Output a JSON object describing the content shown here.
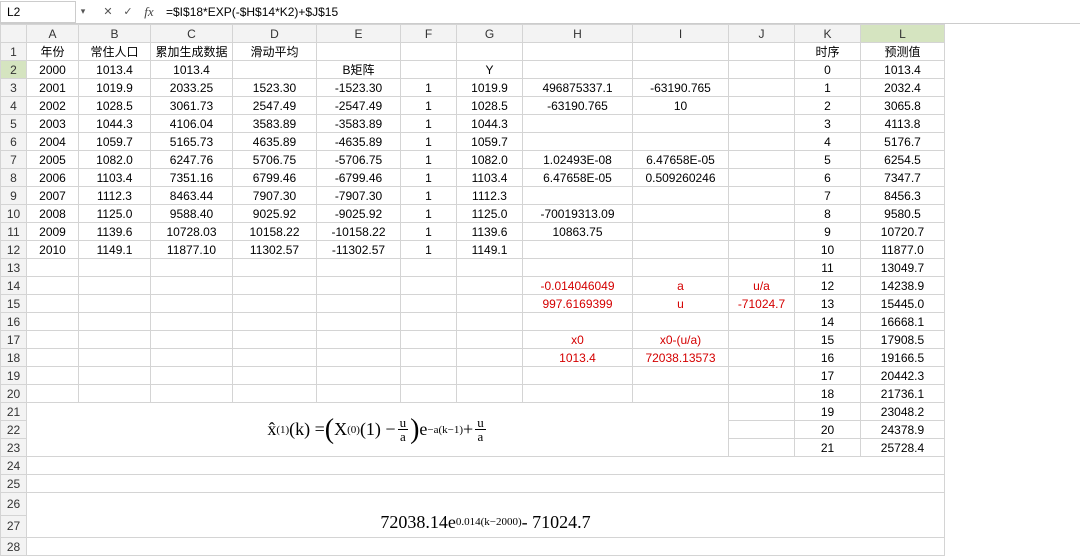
{
  "formula_bar": {
    "name_box": "L2",
    "dropdown_glyph": "▾",
    "btn_cancel": "✕",
    "btn_confirm": "✓",
    "fx": "fx",
    "formula": "=$I$18*EXP(-$H$14*K2)+$J$15"
  },
  "columns": [
    "A",
    "B",
    "C",
    "D",
    "E",
    "F",
    "G",
    "H",
    "I",
    "J",
    "K",
    "L"
  ],
  "selected_cell": "L2",
  "headers": {
    "A": "年份",
    "B": "常住人口",
    "C": "累加生成数据",
    "D": "滑动平均",
    "E_row2": "B矩阵",
    "G_row2": "Y",
    "K": "时序",
    "L": "预测值"
  },
  "rows": [
    {
      "r": 2,
      "A": "2000",
      "B": "1013.4",
      "C": "1013.4",
      "D": "",
      "E": "",
      "F": "",
      "G": "",
      "H": "",
      "I": "",
      "K": "0",
      "L": "1013.4"
    },
    {
      "r": 3,
      "A": "2001",
      "B": "1019.9",
      "C": "2033.25",
      "D": "1523.30",
      "E": "-1523.30",
      "F": "1",
      "G": "1019.9",
      "H": "496875337.1",
      "I": "-63190.765",
      "K": "1",
      "L": "2032.4"
    },
    {
      "r": 4,
      "A": "2002",
      "B": "1028.5",
      "C": "3061.73",
      "D": "2547.49",
      "E": "-2547.49",
      "F": "1",
      "G": "1028.5",
      "H": "-63190.765",
      "I": "10",
      "K": "2",
      "L": "3065.8"
    },
    {
      "r": 5,
      "A": "2003",
      "B": "1044.3",
      "C": "4106.04",
      "D": "3583.89",
      "E": "-3583.89",
      "F": "1",
      "G": "1044.3",
      "H": "",
      "I": "",
      "K": "3",
      "L": "4113.8"
    },
    {
      "r": 6,
      "A": "2004",
      "B": "1059.7",
      "C": "5165.73",
      "D": "4635.89",
      "E": "-4635.89",
      "F": "1",
      "G": "1059.7",
      "H": "",
      "I": "",
      "K": "4",
      "L": "5176.7"
    },
    {
      "r": 7,
      "A": "2005",
      "B": "1082.0",
      "C": "6247.76",
      "D": "5706.75",
      "E": "-5706.75",
      "F": "1",
      "G": "1082.0",
      "H": "1.02493E-08",
      "I": "6.47658E-05",
      "K": "5",
      "L": "6254.5"
    },
    {
      "r": 8,
      "A": "2006",
      "B": "1103.4",
      "C": "7351.16",
      "D": "6799.46",
      "E": "-6799.46",
      "F": "1",
      "G": "1103.4",
      "H": "6.47658E-05",
      "I": "0.509260246",
      "K": "6",
      "L": "7347.7"
    },
    {
      "r": 9,
      "A": "2007",
      "B": "1112.3",
      "C": "8463.44",
      "D": "7907.30",
      "E": "-7907.30",
      "F": "1",
      "G": "1112.3",
      "H": "",
      "I": "",
      "K": "7",
      "L": "8456.3"
    },
    {
      "r": 10,
      "A": "2008",
      "B": "1125.0",
      "C": "9588.40",
      "D": "9025.92",
      "E": "-9025.92",
      "F": "1",
      "G": "1125.0",
      "H": "-70019313.09",
      "I": "",
      "K": "8",
      "L": "9580.5"
    },
    {
      "r": 11,
      "A": "2009",
      "B": "1139.6",
      "C": "10728.03",
      "D": "10158.22",
      "E": "-10158.22",
      "F": "1",
      "G": "1139.6",
      "H": "10863.75",
      "I": "",
      "K": "9",
      "L": "10720.7"
    },
    {
      "r": 12,
      "A": "2010",
      "B": "1149.1",
      "C": "11877.10",
      "D": "11302.57",
      "E": "-11302.57",
      "F": "1",
      "G": "1149.1",
      "H": "",
      "I": "",
      "K": "10",
      "L": "11877.0"
    }
  ],
  "extra": {
    "r13": {
      "K": "11",
      "L": "13049.7"
    },
    "r14": {
      "H": "-0.014046049",
      "I": "a",
      "J": "u/a",
      "K": "12",
      "L": "14238.9"
    },
    "r15": {
      "H": "997.6169399",
      "I": "u",
      "J": "-71024.7",
      "K": "13",
      "L": "15445.0"
    },
    "r16": {
      "K": "14",
      "L": "16668.1"
    },
    "r17": {
      "H": "x0",
      "I": "x0-(u/a)",
      "K": "15",
      "L": "17908.5"
    },
    "r18": {
      "H": "1013.4",
      "I": "72038.13573",
      "K": "16",
      "L": "19166.5"
    },
    "r19": {
      "K": "17",
      "L": "20442.3"
    },
    "r20": {
      "K": "18",
      "L": "21736.1"
    },
    "r21": {
      "K": "19",
      "L": "23048.2"
    },
    "r22": {
      "K": "20",
      "L": "24378.9"
    },
    "r23": {
      "K": "21",
      "L": "25728.4"
    }
  },
  "eq1": {
    "lhs_x": "x̂",
    "lhs_sup": "(1)",
    "lhs_arg": "(k) = ",
    "X": "X",
    "Xsup": "(0)",
    "Xarg": "(1) − ",
    "frac_u": "u",
    "frac_a": "a",
    "exp_e": " e",
    "exp_sup": " −a(k−1)",
    "plus": "+ "
  },
  "eq2": {
    "coef": "72038.14",
    "e": "e",
    "exp": " 0.014(k−2000)",
    "tail": "- 71024.7"
  }
}
